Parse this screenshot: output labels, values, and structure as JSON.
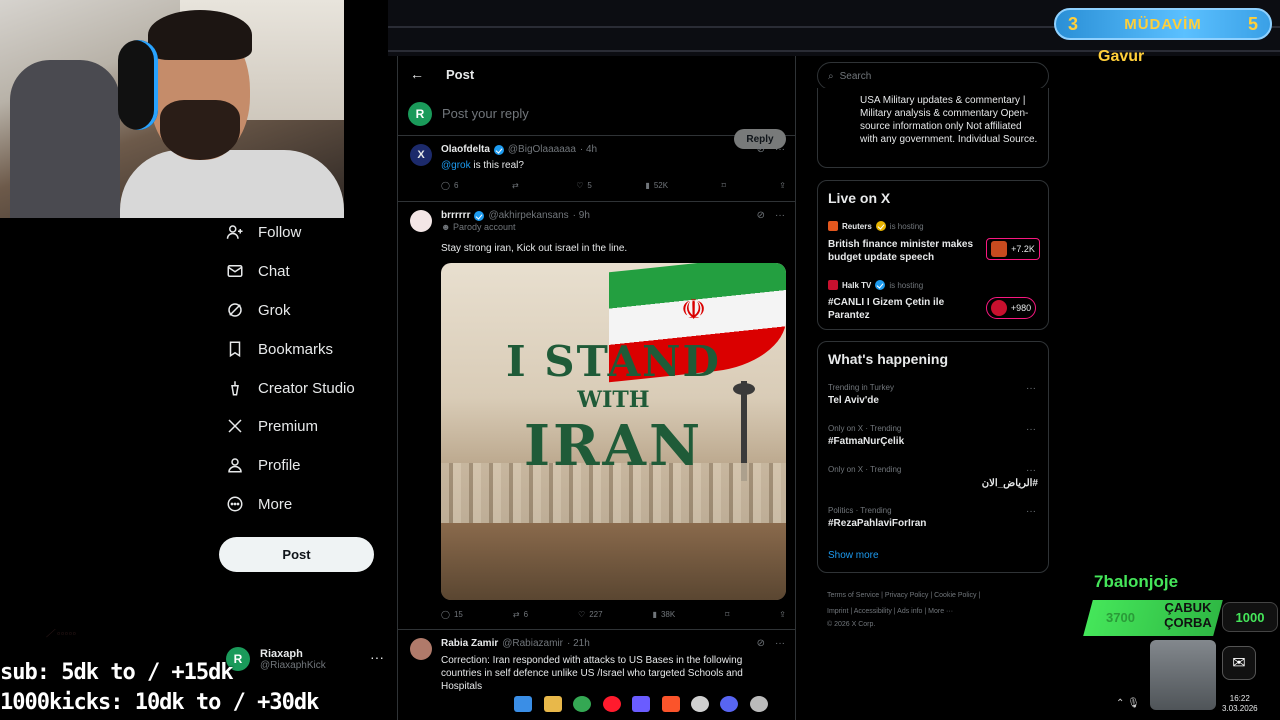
{
  "header": {
    "title": "Post",
    "back": "←"
  },
  "reply": {
    "avatar": "R",
    "placeholder": "Post your reply",
    "button": "Reply"
  },
  "nav": {
    "items": [
      {
        "label": "Follow",
        "icon": "follow-icon"
      },
      {
        "label": "Chat",
        "icon": "chat-icon"
      },
      {
        "label": "Grok",
        "icon": "grok-icon"
      },
      {
        "label": "Bookmarks",
        "icon": "bookmark-icon"
      },
      {
        "label": "Creator Studio",
        "icon": "creator-studio-icon"
      },
      {
        "label": "Premium",
        "icon": "x-logo-icon"
      },
      {
        "label": "Profile",
        "icon": "profile-icon"
      },
      {
        "label": "More",
        "icon": "more-icon"
      }
    ],
    "post_button": "Post"
  },
  "account": {
    "avatar": "R",
    "name": "Riaxaph",
    "handle": "@RiaxaphKick",
    "menu": "···"
  },
  "tweets": [
    {
      "name": "Olaofdelta",
      "handle": "@BigOlaaaaaa",
      "time": "· 4h",
      "mention": "@grok",
      "text": " is this real?",
      "replies": "6",
      "retweets": "",
      "likes": "5",
      "views": "52K"
    },
    {
      "name": "brrrrrr",
      "handle": "@akhirpekansans",
      "time": "· 9h",
      "parody": "Parody account",
      "text": "Stay strong iran, Kick out israel in the line.",
      "image": {
        "line1": "I STAND",
        "line2": "WITH",
        "line3": "IRAN"
      },
      "replies": "15",
      "retweets": "6",
      "likes": "227",
      "views": "38K"
    },
    {
      "name": "Rabia Zamir",
      "handle": "@Rabiazamir",
      "time": "· 21h",
      "text": "Correction: Iran responded with attacks to US Bases in the following countries in self defence unlike US /Israel who targeted Schools and Hospitals"
    }
  ],
  "search": {
    "placeholder": "Search"
  },
  "about": {
    "text": "USA Military updates & commentary | Military analysis & commentary Open-source information only Not affiliated with any government. Individual Source."
  },
  "live": {
    "title": "Live on X",
    "items": [
      {
        "host": "Reuters",
        "status": "is hosting",
        "title": "British finance minister makes budget update speech",
        "count": "+7.2K",
        "color": "#e2571e"
      },
      {
        "host": "Halk TV",
        "status": "is hosting",
        "title": "#CANLI I Gizem Çetin ile Parantez",
        "count": "+980",
        "color": "#c8102e"
      }
    ]
  },
  "trends": {
    "title": "What's happening",
    "items": [
      {
        "meta": "Trending in Turkey",
        "name": "Tel Aviv'de"
      },
      {
        "meta": "Only on X · Trending",
        "name": "#FatmaNurÇelik"
      },
      {
        "meta": "Only on X · Trending",
        "name": "#الرياض_الان"
      },
      {
        "meta": "Politics · Trending",
        "name": "#RezaPahlaviForIran"
      }
    ],
    "show_more": "Show more"
  },
  "footer": {
    "line1": "Terms of Service  |  Privacy Policy  |  Cookie Policy  |",
    "line2": "Imprint  |  Accessibility  |  Ads info  |  More ···",
    "line3": "© 2026 X Corp."
  },
  "overlay": {
    "mudavim_left": "3",
    "mudavim_label": "MÜDAVİM",
    "mudavim_right": "5",
    "gavur": "Gavur",
    "balon": "7balonjoje",
    "corba_num": "3700",
    "corba_text": "ÇABUK ÇORBA",
    "k1000": "1000",
    "sub": "sub: 5dk to / +15dk",
    "kick": "1000kicks: 10dk to / +30dk"
  },
  "taskbar": {
    "time": "16:22",
    "date": "3.03.2026"
  }
}
